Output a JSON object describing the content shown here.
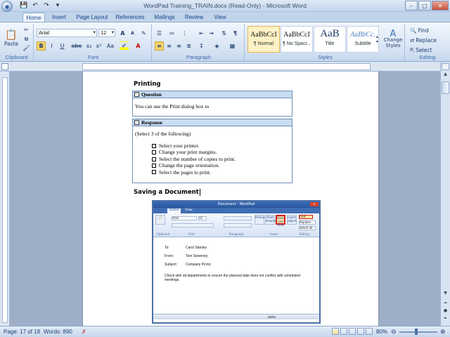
{
  "window": {
    "title": "WordPad Training_TRAIN.docx (Read-Only) - Microsoft Word",
    "office_button_icon": "office-logo-icon",
    "qat_icons": [
      "save-icon",
      "undo-icon",
      "redo-icon",
      "customize-icon"
    ],
    "controls": [
      "–",
      "□",
      "✕"
    ]
  },
  "tabs": [
    {
      "label": "Home",
      "active": true
    },
    {
      "label": "Insert"
    },
    {
      "label": "Page Layout"
    },
    {
      "label": "References"
    },
    {
      "label": "Mailings"
    },
    {
      "label": "Review"
    },
    {
      "label": "View"
    }
  ],
  "ribbon": {
    "clipboard": {
      "label": "Clipboard",
      "paste": "Paste"
    },
    "font": {
      "label": "Font",
      "font_name": "Arial",
      "font_size": "12",
      "bold": "B",
      "italic": "I",
      "underline": "U",
      "strike": "abe",
      "sub": "x₂",
      "sup": "x²",
      "aa": "Aa",
      "grow": "A",
      "shrink": "A"
    },
    "paragraph": {
      "label": "Paragraph",
      "pilcrow": "¶"
    },
    "styles": {
      "label": "Styles",
      "items": [
        {
          "sample": "AaBbCcI",
          "name": "¶ Normal"
        },
        {
          "sample": "AaBbCcI",
          "name": "¶ No Spaci..."
        },
        {
          "sample": "AaB",
          "name": "Title"
        },
        {
          "sample": "AaBbCc.",
          "name": "Subtitle"
        }
      ],
      "change": "Change Styles"
    },
    "editing": {
      "label": "Editing",
      "find": "Find",
      "replace": "Replace",
      "select": "Select"
    }
  },
  "document": {
    "heading_printing": "Printing",
    "question_label": "Question",
    "question_text": "You can use the Print dialog box to",
    "response_label": "Response",
    "response_instr": "(Select 3  of the following)",
    "options": [
      "Select your printer.",
      "Change your print margins.",
      "Select the number of copies to print.",
      "Change the page orientation.",
      "Select the pages to print."
    ],
    "heading_saving": "Saving a Document",
    "embedded": {
      "title": "Document - WordPad",
      "tabs": [
        "Home",
        "View"
      ],
      "font": "Arial",
      "size": "12",
      "groups": [
        "Clipboard",
        "Font",
        "Paragraph",
        "Insert",
        "Editing"
      ],
      "big_buttons": [
        "Picture",
        "Paint drawing",
        "Date and time",
        "Insert object"
      ],
      "edit_btns": [
        "Find",
        "Replace",
        "Select all"
      ],
      "fields": [
        {
          "k": "To:",
          "v": "Carol Stanley"
        },
        {
          "k": "From:",
          "v": "Tom Sweeney"
        },
        {
          "k": "Subject:",
          "v": "Company Picnic"
        }
      ],
      "body": "Check with all departments to ensure the planned date does not conflict with scheduled meetings.",
      "zoom": "100%"
    }
  },
  "status": {
    "page": "Page: 17 of 18",
    "words": "Words: 890",
    "zoom": "80%"
  }
}
